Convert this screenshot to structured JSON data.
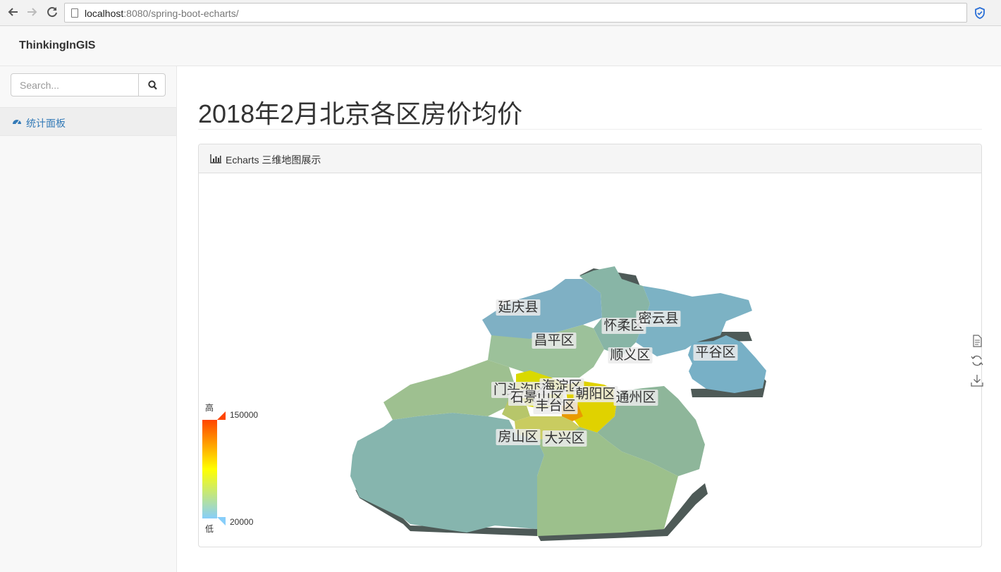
{
  "browser": {
    "url_host": "localhost",
    "url_rest": ":8080/spring-boot-echarts/",
    "back_icon": "arrow-left-icon",
    "forward_icon": "arrow-right-icon",
    "reload_icon": "reload-icon",
    "extension_icon": "shield-icon"
  },
  "navbar": {
    "brand": "ThinkingInGIS"
  },
  "sidebar": {
    "search": {
      "placeholder": "Search...",
      "button_icon": "search-icon"
    },
    "items": [
      {
        "label": "统计面板",
        "icon": "dashboard-icon"
      }
    ]
  },
  "main": {
    "title": "2018年2月北京各区房价均价",
    "panel": {
      "heading": "Echarts 三维地图展示",
      "heading_icon": "bar-chart-icon"
    }
  },
  "chart_data": {
    "type": "map3d",
    "region": "北京",
    "districts": [
      {
        "name": "延庆县"
      },
      {
        "name": "怀柔区"
      },
      {
        "name": "密云县"
      },
      {
        "name": "平谷区"
      },
      {
        "name": "昌平区"
      },
      {
        "name": "顺义区"
      },
      {
        "name": "门头沟区"
      },
      {
        "name": "海淀区"
      },
      {
        "name": "石景山区"
      },
      {
        "name": "朝阳区"
      },
      {
        "name": "丰台区"
      },
      {
        "name": "通州区"
      },
      {
        "name": "房山区"
      },
      {
        "name": "大兴区"
      }
    ],
    "visual_map": {
      "min": 20000,
      "max": 150000,
      "min_label": "20000",
      "max_label": "150000",
      "text_high": "高",
      "text_low": "低",
      "colors": [
        "#87cefa",
        "#ffff00",
        "#ff4500"
      ]
    },
    "toolbox": [
      "data-view-icon",
      "restore-icon",
      "save-image-icon"
    ]
  }
}
